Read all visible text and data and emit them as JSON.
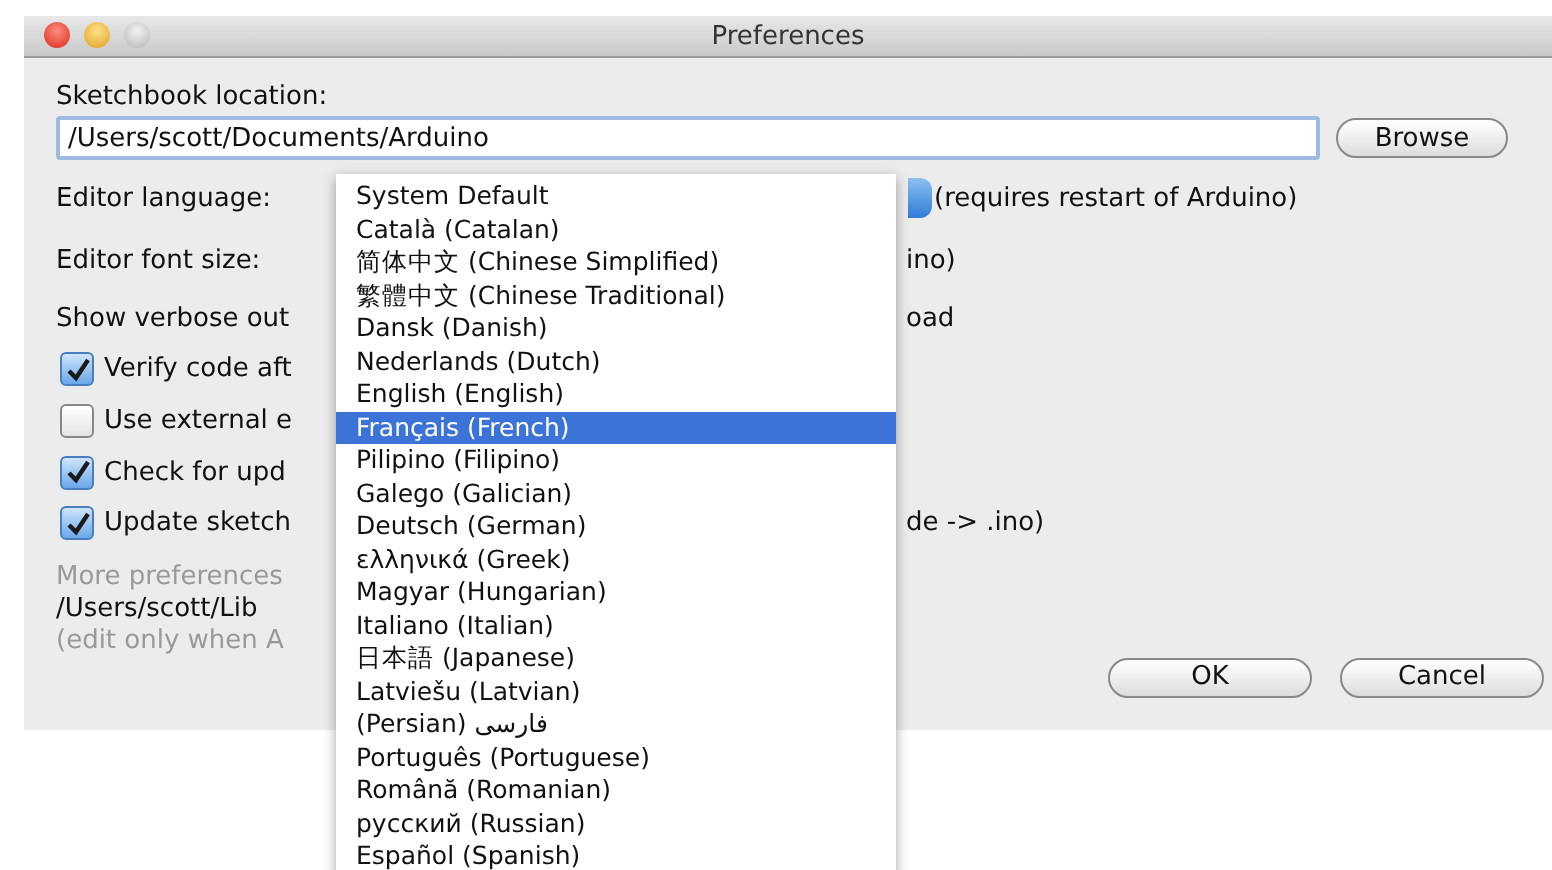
{
  "window": {
    "title": "Preferences"
  },
  "sketchbook": {
    "label": "Sketchbook location:",
    "value": "/Users/scott/Documents/Arduino",
    "button": "Browse"
  },
  "language": {
    "label": "Editor language:",
    "note": "(requires restart of Arduino)"
  },
  "font_size": {
    "label": "Editor font size:",
    "tail": "ino)"
  },
  "verbose": {
    "label": "Show verbose out",
    "tail": "oad"
  },
  "checkboxes": [
    {
      "label": "Verify code aft",
      "checked": true
    },
    {
      "label": "Use external e",
      "checked": false
    },
    {
      "label": "Check for upd",
      "checked": true
    },
    {
      "label": "Update sketch",
      "tail": "de -> .ino)",
      "checked": true
    }
  ],
  "more": {
    "heading": "More preferences",
    "path": "/Users/scott/Lib",
    "hint": "(edit only when A"
  },
  "buttons": [
    "OK",
    "Cancel"
  ],
  "menu": [
    {
      "label": "System Default",
      "selected": false
    },
    {
      "label": "Català (Catalan)",
      "selected": false
    },
    {
      "label": "简体中文 (Chinese Simplified)",
      "selected": false
    },
    {
      "label": "繁體中文 (Chinese Traditional)",
      "selected": false
    },
    {
      "label": "Dansk (Danish)",
      "selected": false
    },
    {
      "label": "Nederlands (Dutch)",
      "selected": false
    },
    {
      "label": "English (English)",
      "selected": false
    },
    {
      "label": "Français (French)",
      "selected": true
    },
    {
      "label": "Pilipino (Filipino)",
      "selected": false
    },
    {
      "label": "Galego (Galician)",
      "selected": false
    },
    {
      "label": "Deutsch (German)",
      "selected": false
    },
    {
      "label": "ελληνικά (Greek)",
      "selected": false
    },
    {
      "label": "Magyar (Hungarian)",
      "selected": false
    },
    {
      "label": "Italiano (Italian)",
      "selected": false
    },
    {
      "label": "日本語 (Japanese)",
      "selected": false
    },
    {
      "label": "Latviešu (Latvian)",
      "selected": false
    },
    {
      "label": "(Persian) فارسی",
      "selected": false
    },
    {
      "label": "Português (Portuguese)",
      "selected": false
    },
    {
      "label": "Română (Romanian)",
      "selected": false
    },
    {
      "label": "русский (Russian)",
      "selected": false
    },
    {
      "label": "Español (Spanish)",
      "selected": false
    }
  ]
}
